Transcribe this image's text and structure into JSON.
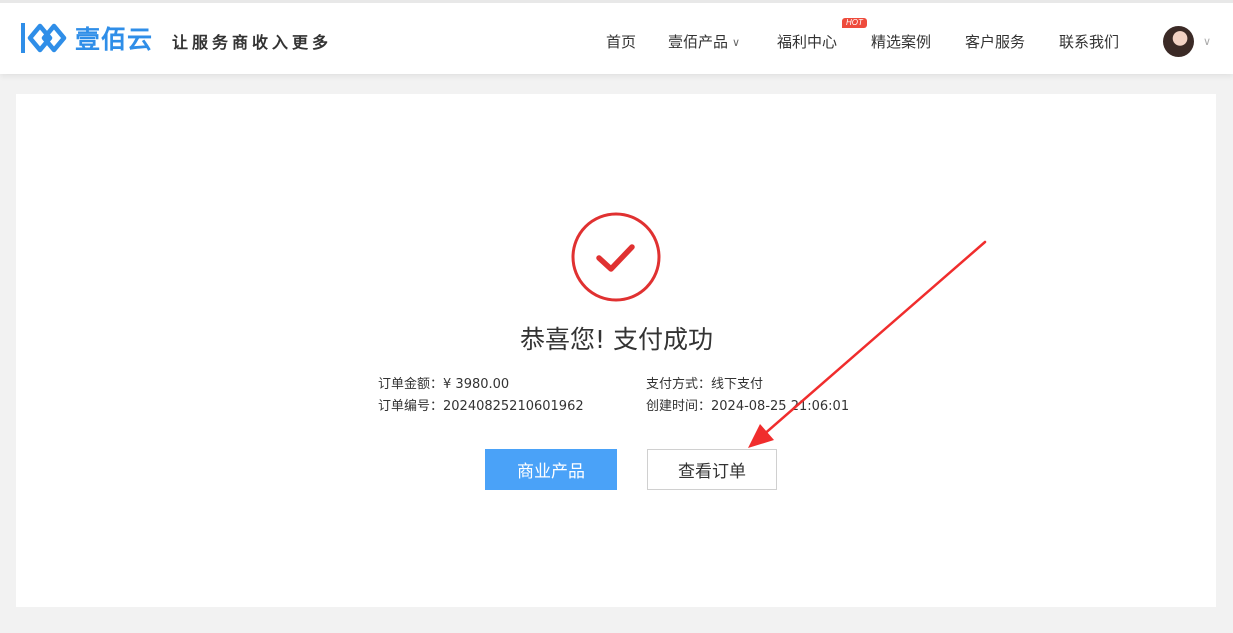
{
  "header": {
    "logo_text": "壹佰云",
    "slogan": "让服务商收入更多",
    "nav": [
      {
        "label": "首页"
      },
      {
        "label": "壹佰产品"
      },
      {
        "label": "福利中心"
      },
      {
        "label": "精选案例"
      },
      {
        "label": "客户服务"
      },
      {
        "label": "联系我们"
      }
    ],
    "hot_badge": "HOT",
    "brand_color": "#2f8ee8"
  },
  "result": {
    "title": "恭喜您! 支付成功",
    "icon": "check-circle-icon",
    "icon_color": "#e03131",
    "amount_label": "订单金额：",
    "amount_value": "¥ 3980.00",
    "order_no_label": "订单编号：",
    "order_no_value": "20240825210601962",
    "pay_method_label": "支付方式：",
    "pay_method_value": "线下支付",
    "created_label": "创建时间：",
    "created_value": "2024-08-25 21:06:01"
  },
  "actions": {
    "primary": "商业产品",
    "secondary": "查看订单",
    "primary_color": "#4aa2f8"
  },
  "annotation": {
    "arrow_color": "#f02d2d"
  }
}
